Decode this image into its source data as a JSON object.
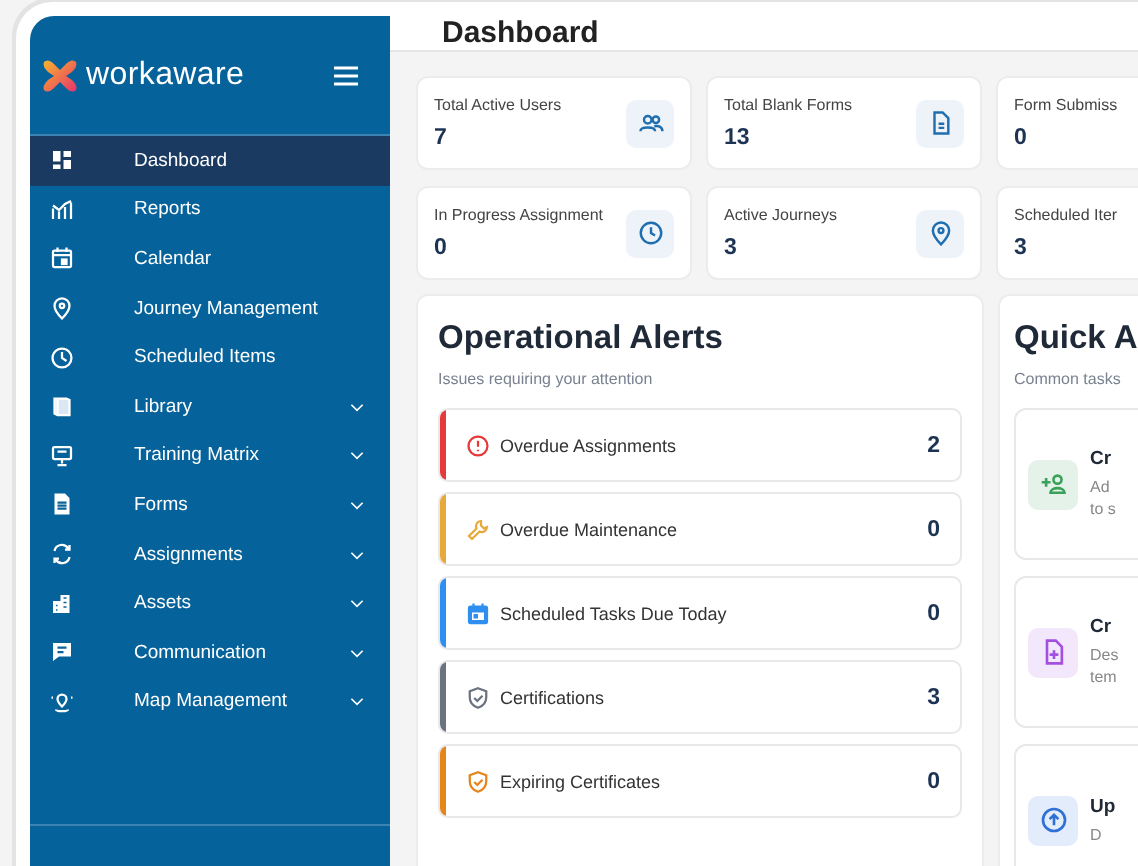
{
  "brand": {
    "name": "workaware"
  },
  "sidebar": {
    "items": [
      {
        "label": "Dashboard",
        "selected": true,
        "expandable": false
      },
      {
        "label": "Reports",
        "selected": false,
        "expandable": false
      },
      {
        "label": "Calendar",
        "selected": false,
        "expandable": false
      },
      {
        "label": "Journey Management",
        "selected": false,
        "expandable": false
      },
      {
        "label": "Scheduled Items",
        "selected": false,
        "expandable": false
      },
      {
        "label": "Library",
        "selected": false,
        "expandable": true
      },
      {
        "label": "Training Matrix",
        "selected": false,
        "expandable": true
      },
      {
        "label": "Forms",
        "selected": false,
        "expandable": true
      },
      {
        "label": "Assignments",
        "selected": false,
        "expandable": true
      },
      {
        "label": "Assets",
        "selected": false,
        "expandable": true
      },
      {
        "label": "Communication",
        "selected": false,
        "expandable": true
      },
      {
        "label": "Map Management",
        "selected": false,
        "expandable": true
      }
    ]
  },
  "header": {
    "title": "Dashboard"
  },
  "stats": [
    {
      "label": "Total Active Users",
      "value": "7"
    },
    {
      "label": "Total Blank Forms",
      "value": "13"
    },
    {
      "label": "Form Submiss",
      "value": "0"
    },
    {
      "label": "In Progress Assignment",
      "value": "0"
    },
    {
      "label": "Active Journeys",
      "value": "3"
    },
    {
      "label": "Scheduled Iter",
      "value": "3"
    }
  ],
  "alerts": {
    "title": "Operational Alerts",
    "subtitle": "Issues requiring your attention",
    "items": [
      {
        "label": "Overdue Assignments",
        "count": "2",
        "color": "#e5393b"
      },
      {
        "label": "Overdue Maintenance",
        "count": "0",
        "color": "#e8a93c"
      },
      {
        "label": "Scheduled Tasks Due Today",
        "count": "0",
        "color": "#2f8ff0"
      },
      {
        "label": "Certifications",
        "count": "3",
        "color": "#6b7280"
      },
      {
        "label": "Expiring Certificates",
        "count": "0",
        "color": "#e5851a"
      }
    ]
  },
  "quick_actions": {
    "title": "Quick A",
    "subtitle": "Common tasks",
    "items": [
      {
        "title": "Cr",
        "description": [
          "Ad",
          "to s"
        ],
        "color": "#3aa05a"
      },
      {
        "title": "Cr",
        "description": [
          "Des",
          "tem"
        ],
        "color": "#a34fe0"
      },
      {
        "title": "Up",
        "description": [
          "D"
        ],
        "color": "#2f6fd8"
      }
    ]
  }
}
